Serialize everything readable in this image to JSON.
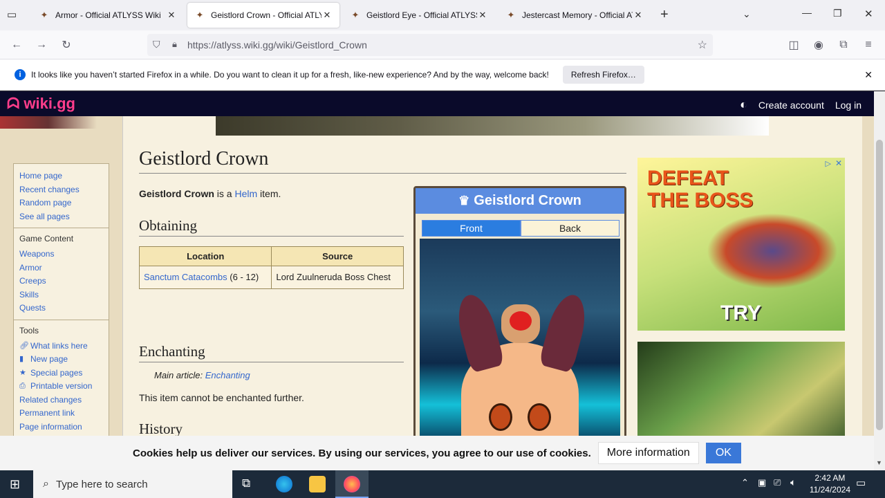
{
  "browser": {
    "tabs": [
      {
        "title": "Armor - Official ATLYSS Wiki"
      },
      {
        "title": "Geistlord Crown - Official ATLYSS Wiki"
      },
      {
        "title": "Geistlord Eye - Official ATLYSS Wiki"
      },
      {
        "title": "Jestercast Memory - Official ATLYSS Wiki"
      }
    ],
    "url": "https://atlyss.wiki.gg/wiki/Geistlord_Crown",
    "notification": {
      "text": "It looks like you haven’t started Firefox in a while. Do you want to clean it up for a fresh, like-new experience? And by the way, welcome back!",
      "button": "Refresh Firefox…"
    }
  },
  "wiki": {
    "logo": "wiki.gg",
    "create_account": "Create account",
    "login": "Log in",
    "sidebar": {
      "nav": [
        "Home page",
        "Recent changes",
        "Random page",
        "See all pages"
      ],
      "game_content_heading": "Game Content",
      "game_content": [
        "Weapons",
        "Armor",
        "Creeps",
        "Skills",
        "Quests"
      ],
      "tools_heading": "Tools",
      "tools": [
        "What links here",
        "New page",
        "Special pages",
        "Printable version",
        "Related changes",
        "Permanent link",
        "Page information"
      ]
    },
    "article": {
      "title": "Geistlord Crown",
      "intro_bold": "Geistlord Crown",
      "intro_mid": " is a ",
      "intro_link": "Helm",
      "intro_end": " item.",
      "obtaining": "Obtaining",
      "table_headers": [
        "Location",
        "Source"
      ],
      "table_location_link": "Sanctum Catacombs",
      "table_location_rest": " (6 - 12)",
      "table_source": "Lord Zuulneruda Boss Chest",
      "enchanting": "Enchanting",
      "main_article_label": "Main article: ",
      "main_article_link": "Enchanting",
      "enchant_text": "This item cannot be enchanted further.",
      "history": "History"
    },
    "infobox": {
      "title": "Geistlord Crown",
      "tab_front": "Front",
      "tab_back": "Back"
    },
    "cookie": {
      "text": "Cookies help us deliver our services. By using our services, you agree to our use of cookies.",
      "more": "More information",
      "ok": "OK"
    }
  },
  "ad": {
    "line1": "DEFEAT",
    "line2": "THE BOSS",
    "cta": "TRY"
  },
  "taskbar": {
    "search_placeholder": "Type here to search",
    "time": "2:42 AM",
    "date": "11/24/2024"
  }
}
